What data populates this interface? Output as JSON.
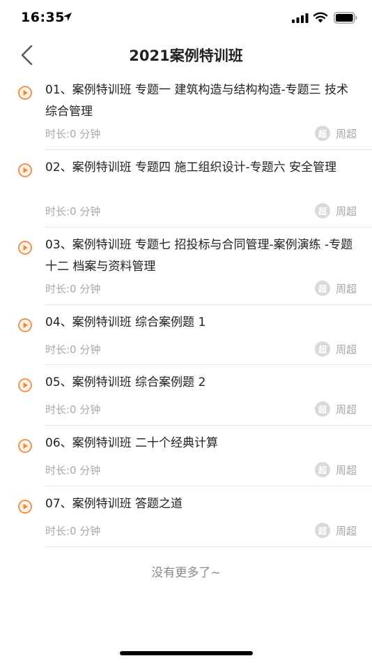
{
  "status_bar": {
    "time": "16:35"
  },
  "nav": {
    "title": "2021案例特训班",
    "back_icon": "chevron-left-icon"
  },
  "lessons": [
    {
      "title": "01、案例特训班 专题一 建筑构造与结构构造-专题三 技术综合管理",
      "duration": "时长:0 分钟",
      "avatar_text": "超",
      "teacher": "周超"
    },
    {
      "title": "02、案例特训班 专题四 施工组织设计-专题六 安全管理",
      "duration": "时长:0 分钟",
      "avatar_text": "超",
      "teacher": "周超"
    },
    {
      "title": "03、案例特训班 专题七 招投标与合同管理-案例演练 -专题十二 档案与资料管理",
      "duration": "时长:0 分钟",
      "avatar_text": "超",
      "teacher": "周超"
    },
    {
      "title": "04、案例特训班 综合案例题 1",
      "duration": "时长:0 分钟",
      "avatar_text": "超",
      "teacher": "周超"
    },
    {
      "title": "05、案例特训班 综合案例题 2",
      "duration": "时长:0 分钟",
      "avatar_text": "超",
      "teacher": "周超"
    },
    {
      "title": "06、案例特训班 二十个经典计算",
      "duration": "时长:0 分钟",
      "avatar_text": "超",
      "teacher": "周超"
    },
    {
      "title": "07、案例特训班 答题之道",
      "duration": "时长:0 分钟",
      "avatar_text": "超",
      "teacher": "周超"
    }
  ],
  "end_text": "没有更多了~",
  "colors": {
    "accent": "#f08a3c",
    "muted_text": "#a8a8a8",
    "divider": "#e6e6e6"
  }
}
